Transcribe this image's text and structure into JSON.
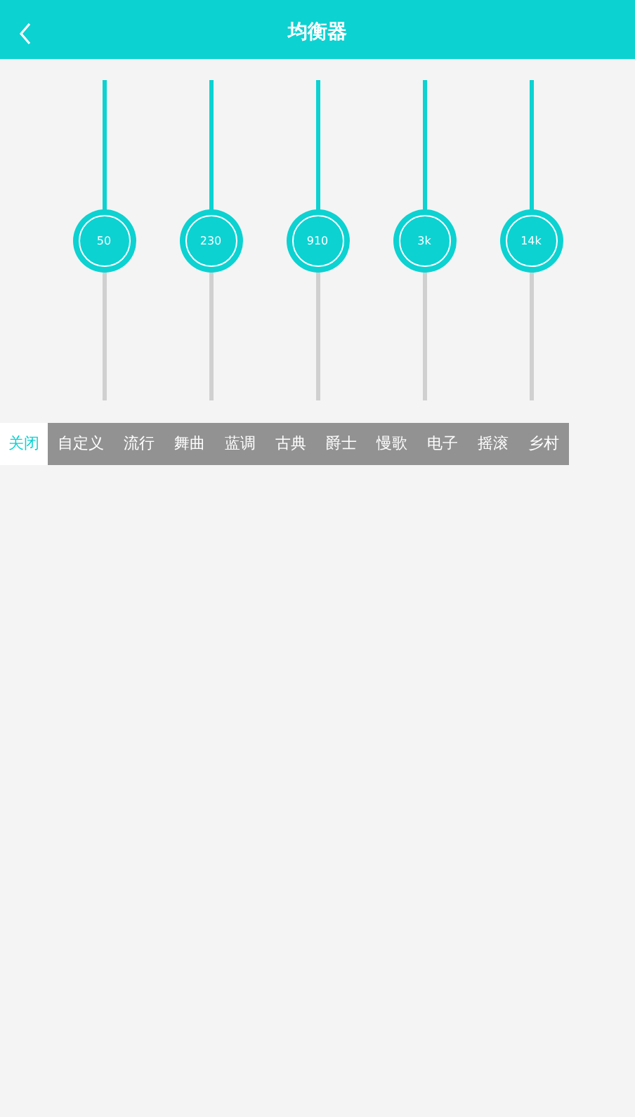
{
  "header": {
    "title": "均衡器"
  },
  "bands": [
    {
      "label": "50",
      "level": 0.5
    },
    {
      "label": "230",
      "level": 0.5
    },
    {
      "label": "910",
      "level": 0.5
    },
    {
      "label": "3k",
      "level": 0.5
    },
    {
      "label": "14k",
      "level": 0.5
    }
  ],
  "presets": [
    {
      "label": "关闭",
      "selected": true
    },
    {
      "label": "自定义",
      "selected": false
    },
    {
      "label": "流行",
      "selected": false
    },
    {
      "label": "舞曲",
      "selected": false
    },
    {
      "label": "蓝调",
      "selected": false
    },
    {
      "label": "古典",
      "selected": false
    },
    {
      "label": "爵士",
      "selected": false
    },
    {
      "label": "慢歌",
      "selected": false
    },
    {
      "label": "电子",
      "selected": false
    },
    {
      "label": "摇滚",
      "selected": false
    },
    {
      "label": "乡村",
      "selected": false
    }
  ]
}
